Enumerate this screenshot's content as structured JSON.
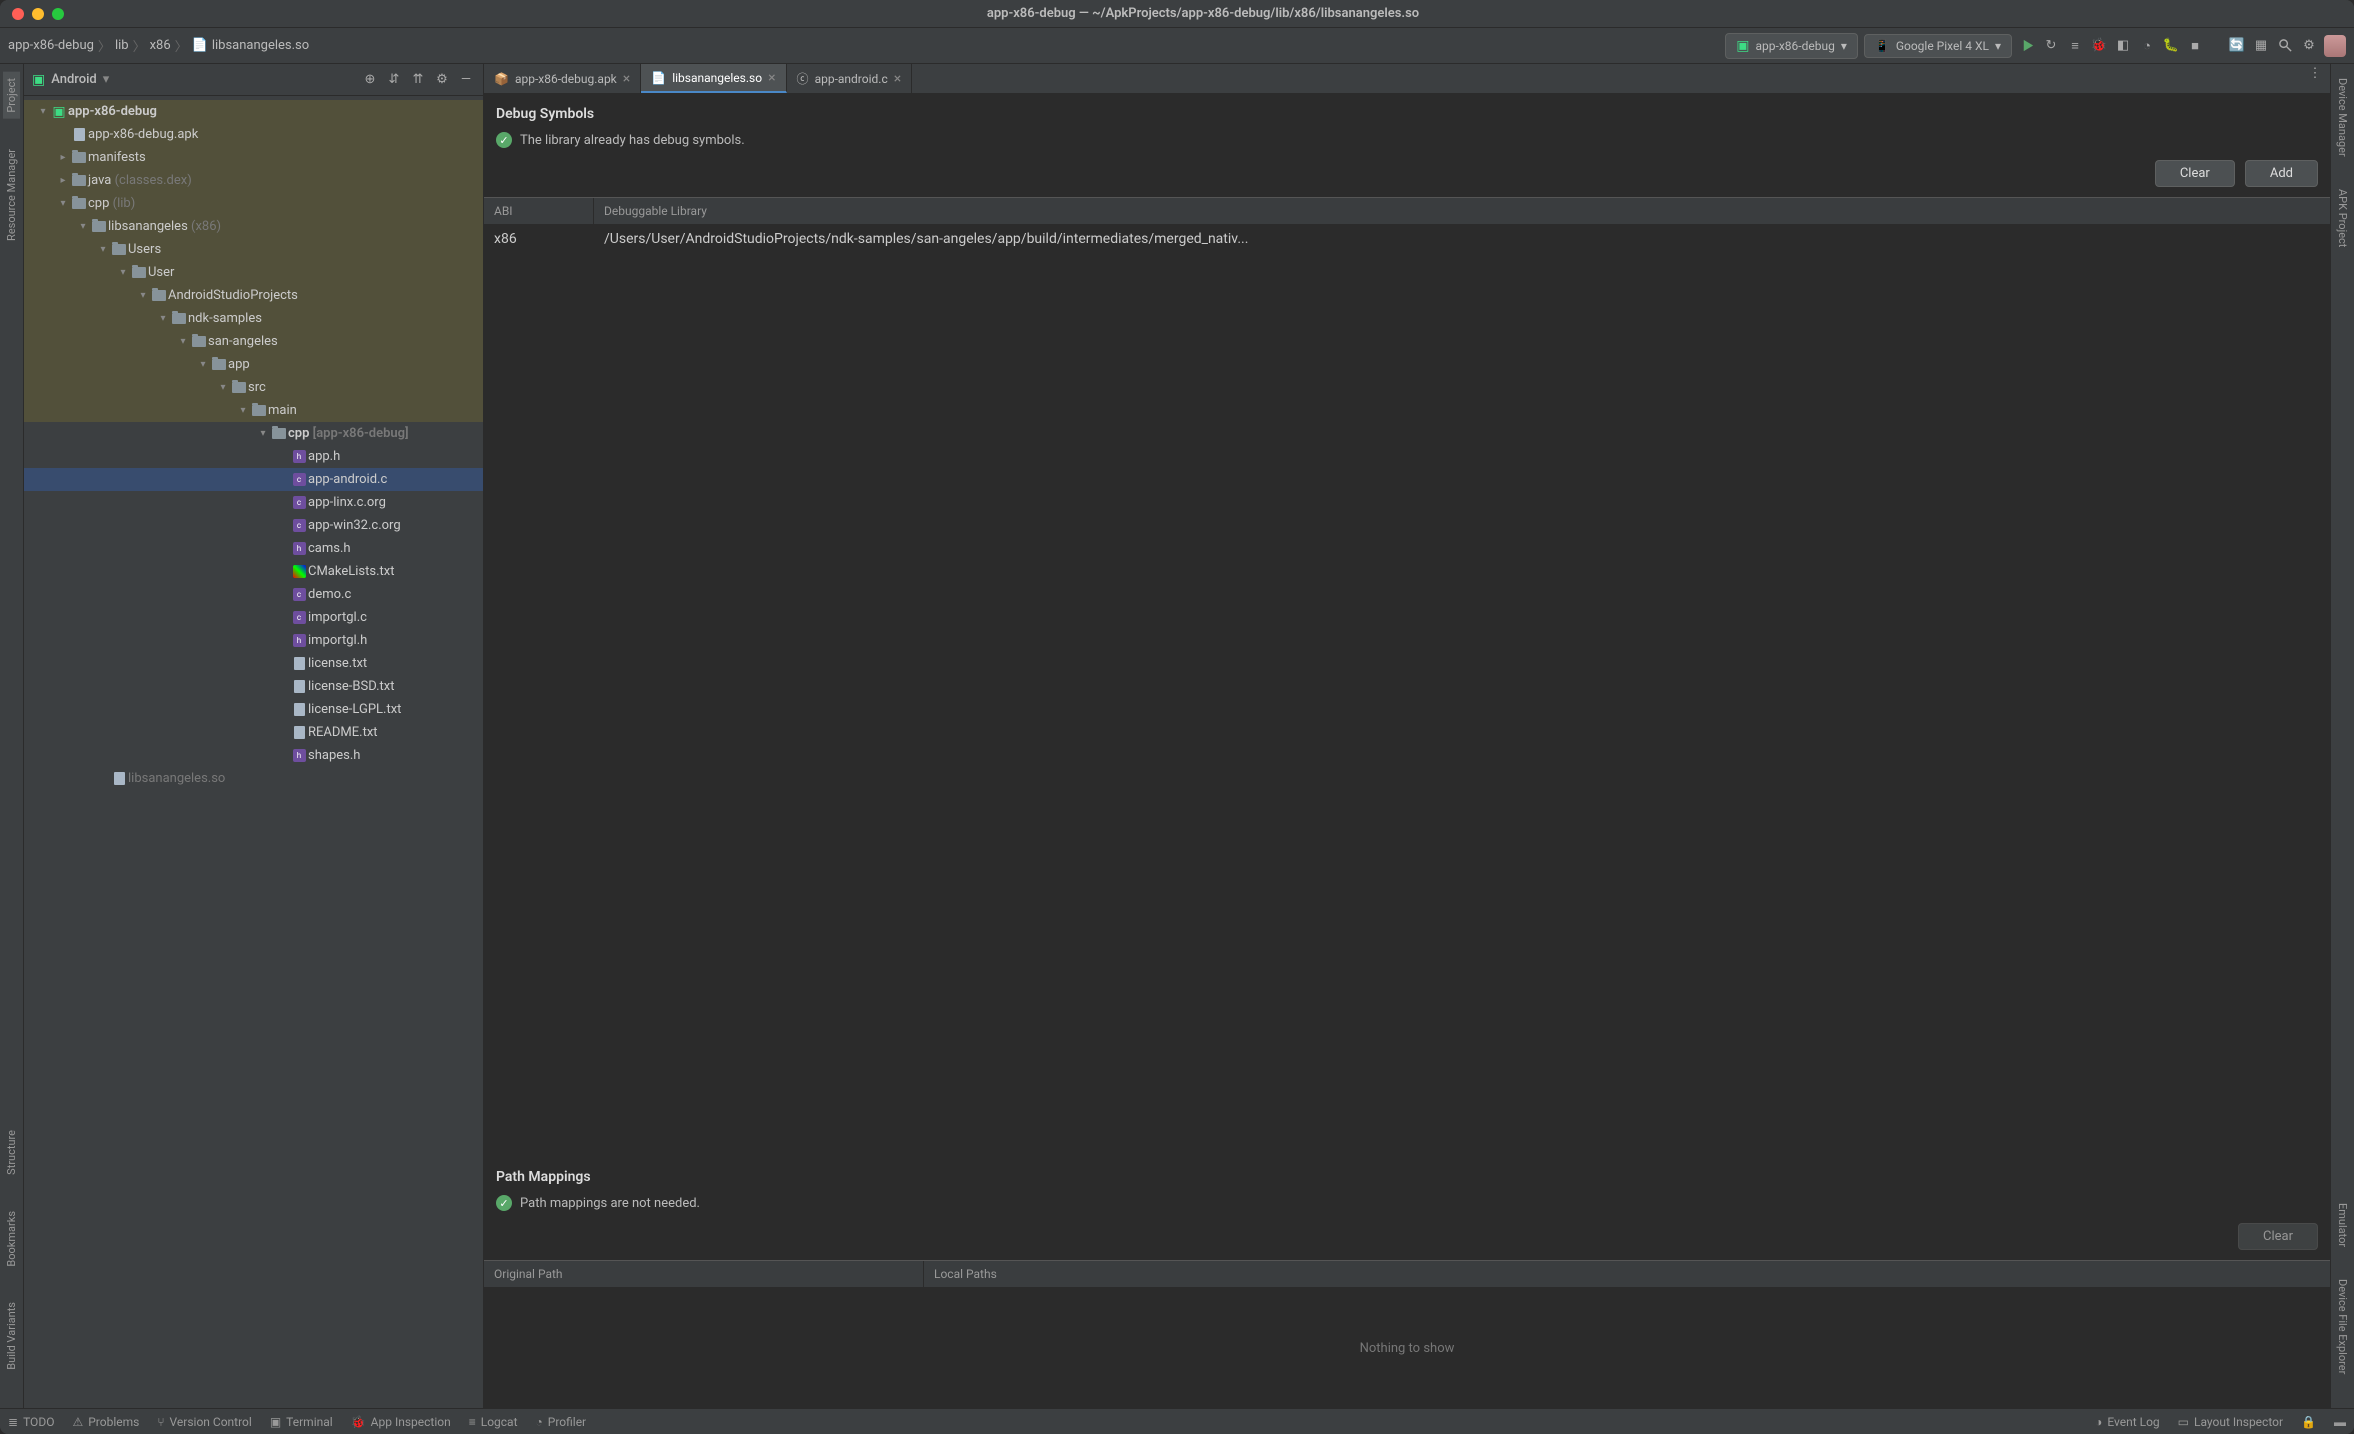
{
  "window_title": "app-x86-debug — ~/ApkProjects/app-x86-debug/lib/x86/libsanangeles.so",
  "breadcrumb": [
    "app-x86-debug",
    "lib",
    "x86",
    "libsanangeles.so"
  ],
  "run_config": "app-x86-debug",
  "device": "Google Pixel 4 XL",
  "project_selector": "Android",
  "left_rail": [
    "Project",
    "Resource Manager",
    "Structure",
    "Bookmarks",
    "Build Variants"
  ],
  "right_rail": [
    "Device Manager",
    "APK Project",
    "Emulator",
    "Device File Explorer"
  ],
  "tree": [
    {
      "d": 0,
      "exp": "v",
      "ico": "android",
      "txt": "app-x86-debug",
      "bold": true,
      "shade": true
    },
    {
      "d": 1,
      "exp": "",
      "ico": "file",
      "txt": "app-x86-debug.apk",
      "shade": true
    },
    {
      "d": 1,
      "exp": ">",
      "ico": "folder",
      "txt": "manifests",
      "shade": true
    },
    {
      "d": 1,
      "exp": ">",
      "ico": "folder",
      "txt": "java",
      "dim": "(classes.dex)",
      "shade": true
    },
    {
      "d": 1,
      "exp": "v",
      "ico": "folder",
      "txt": "cpp",
      "dim": "(lib)",
      "shade": true
    },
    {
      "d": 2,
      "exp": "v",
      "ico": "folder",
      "txt": "libsanangeles",
      "dim": "(x86)",
      "shade": true
    },
    {
      "d": 3,
      "exp": "v",
      "ico": "folder",
      "txt": "Users",
      "shade": true
    },
    {
      "d": 4,
      "exp": "v",
      "ico": "folder",
      "txt": "User",
      "shade": true
    },
    {
      "d": 5,
      "exp": "v",
      "ico": "folder",
      "txt": "AndroidStudioProjects",
      "shade": true
    },
    {
      "d": 6,
      "exp": "v",
      "ico": "folder",
      "txt": "ndk-samples",
      "shade": true
    },
    {
      "d": 7,
      "exp": "v",
      "ico": "folder",
      "txt": "san-angeles",
      "shade": true
    },
    {
      "d": 8,
      "exp": "v",
      "ico": "folder",
      "txt": "app",
      "shade": true
    },
    {
      "d": 9,
      "exp": "v",
      "ico": "folder",
      "txt": "src",
      "shade": true
    },
    {
      "d": 10,
      "exp": "v",
      "ico": "folder",
      "txt": "main",
      "shade": true
    },
    {
      "d": 11,
      "exp": "v",
      "ico": "folder",
      "txt": "cpp",
      "dim": "[app-x86-debug]",
      "bold": true
    },
    {
      "d": 12,
      "exp": "",
      "ico": "h",
      "txt": "app.h"
    },
    {
      "d": 12,
      "exp": "",
      "ico": "c",
      "txt": "app-android.c",
      "sel": true
    },
    {
      "d": 12,
      "exp": "",
      "ico": "c",
      "txt": "app-linx.c.org"
    },
    {
      "d": 12,
      "exp": "",
      "ico": "c",
      "txt": "app-win32.c.org"
    },
    {
      "d": 12,
      "exp": "",
      "ico": "h",
      "txt": "cams.h"
    },
    {
      "d": 12,
      "exp": "",
      "ico": "cmake",
      "txt": "CMakeLists.txt"
    },
    {
      "d": 12,
      "exp": "",
      "ico": "c",
      "txt": "demo.c"
    },
    {
      "d": 12,
      "exp": "",
      "ico": "c",
      "txt": "importgl.c"
    },
    {
      "d": 12,
      "exp": "",
      "ico": "h",
      "txt": "importgl.h"
    },
    {
      "d": 12,
      "exp": "",
      "ico": "file",
      "txt": "license.txt"
    },
    {
      "d": 12,
      "exp": "",
      "ico": "file",
      "txt": "license-BSD.txt"
    },
    {
      "d": 12,
      "exp": "",
      "ico": "file",
      "txt": "license-LGPL.txt"
    },
    {
      "d": 12,
      "exp": "",
      "ico": "file",
      "txt": "README.txt"
    },
    {
      "d": 12,
      "exp": "",
      "ico": "h",
      "txt": "shapes.h"
    },
    {
      "d": 3,
      "exp": "",
      "ico": "file",
      "txt": "libsanangeles.so",
      "dimall": true
    }
  ],
  "tabs": [
    {
      "label": "app-x86-debug.apk",
      "active": false
    },
    {
      "label": "libsanangeles.so",
      "active": true
    },
    {
      "label": "app-android.c",
      "active": false
    }
  ],
  "debug": {
    "title": "Debug Symbols",
    "status": "The library already has debug symbols.",
    "btn_clear": "Clear",
    "btn_add": "Add",
    "col_abi": "ABI",
    "col_lib": "Debuggable Library",
    "row_abi": "x86",
    "row_lib": "/Users/User/AndroidStudioProjects/ndk-samples/san-angeles/app/build/intermediates/merged_nativ..."
  },
  "paths": {
    "title": "Path Mappings",
    "status": "Path mappings are not needed.",
    "btn_clear": "Clear",
    "col_op": "Original Path",
    "col_lp": "Local Paths",
    "empty": "Nothing to show"
  },
  "status_bar": {
    "todo": "TODO",
    "problems": "Problems",
    "vcs": "Version Control",
    "terminal": "Terminal",
    "appinsp": "App Inspection",
    "logcat": "Logcat",
    "profiler": "Profiler",
    "eventlog": "Event Log",
    "layoutinsp": "Layout Inspector"
  }
}
